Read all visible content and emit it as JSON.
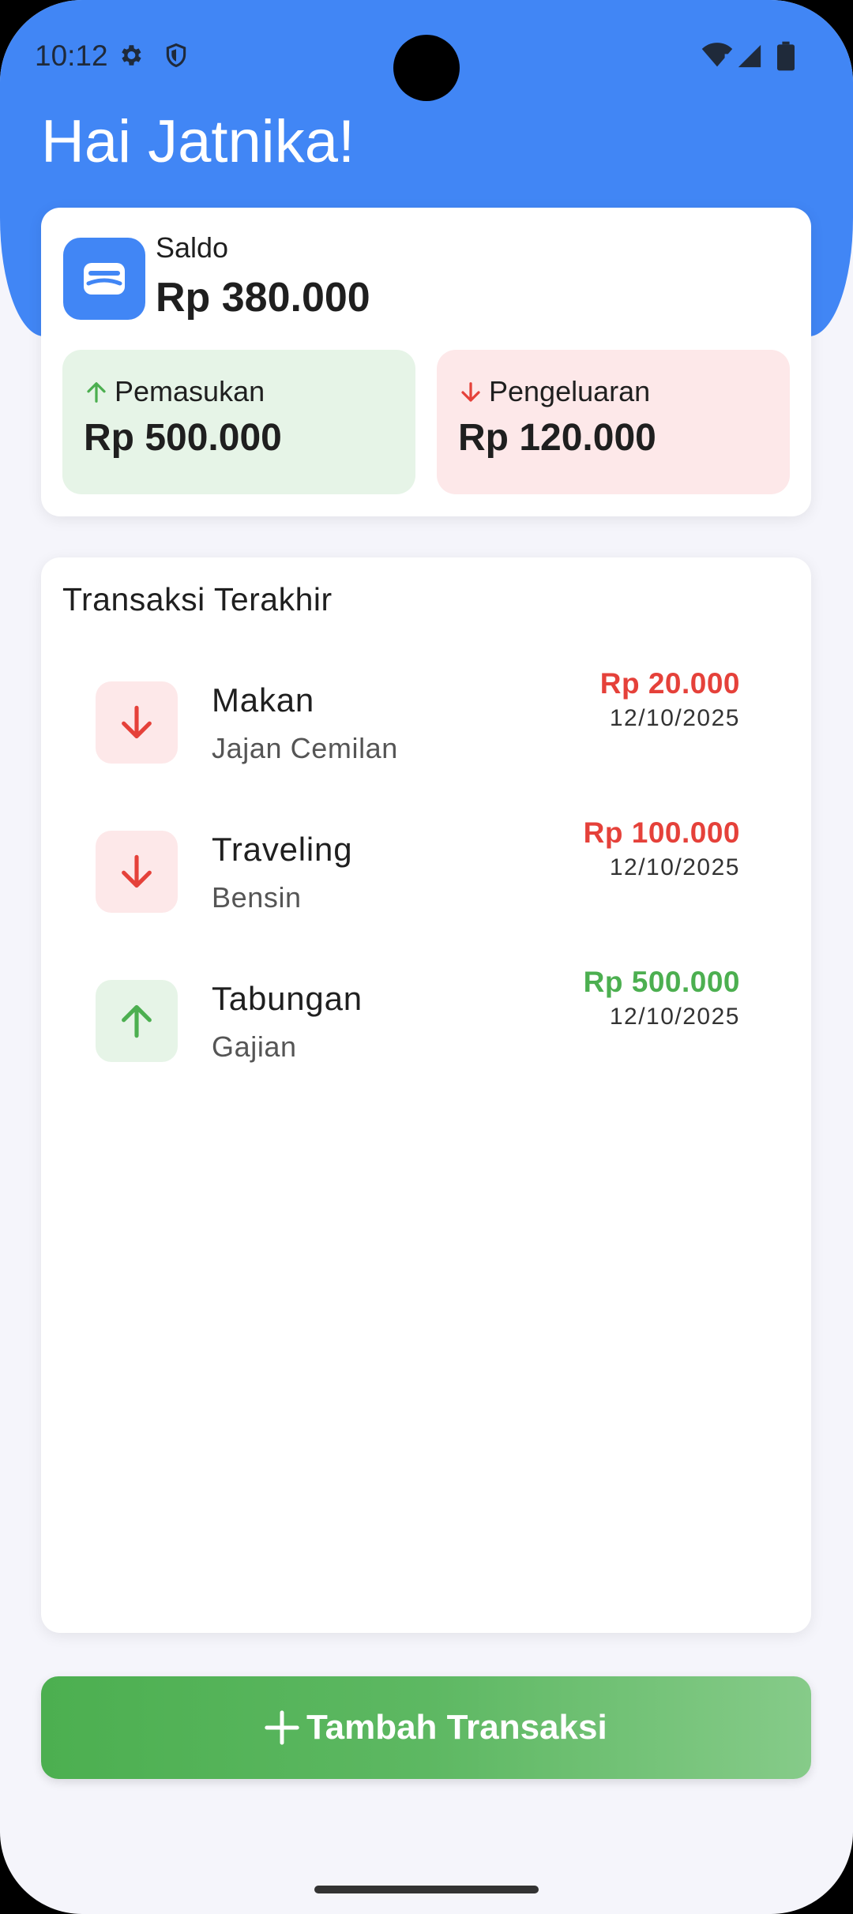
{
  "status_bar": {
    "time": "10:12"
  },
  "greeting": "Hai Jatnika!",
  "balance": {
    "label": "Saldo",
    "value": "Rp 380.000",
    "income": {
      "label": "Pemasukan",
      "value": "Rp 500.000"
    },
    "expense": {
      "label": "Pengeluaran",
      "value": "Rp 120.000"
    }
  },
  "transactions": {
    "title": "Transaksi Terakhir",
    "items": [
      {
        "category": "Makan",
        "note": "Jajan Cemilan",
        "amount": "Rp 20.000",
        "date": "12/10/2025",
        "type": "expense",
        "icon": "arrow-down-icon"
      },
      {
        "category": "Traveling",
        "note": "Bensin",
        "amount": "Rp 100.000",
        "date": "12/10/2025",
        "type": "expense",
        "icon": "arrow-down-icon"
      },
      {
        "category": "Tabungan",
        "note": "Gajian",
        "amount": "Rp 500.000",
        "date": "12/10/2025",
        "type": "income",
        "icon": "arrow-up-icon"
      }
    ]
  },
  "add_button": {
    "label": "Tambah Transaksi",
    "icon": "plus-icon"
  },
  "colors": {
    "primary": "#4186F5",
    "income": "#4CAF50",
    "expense": "#E5413A",
    "income_bg": "#E6F4E7",
    "expense_bg": "#FDE8E9"
  }
}
